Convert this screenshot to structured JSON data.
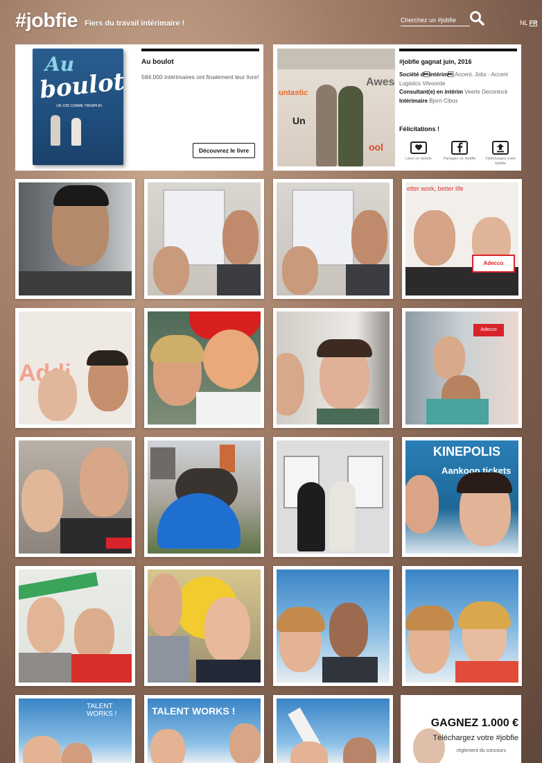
{
  "header": {
    "logo": "#jobfie",
    "tagline": "Fiers du travail intérimaire !",
    "search_placeholder": "Cherchez un #jobfie",
    "lang_nl": "NL",
    "lang_fr": "FR"
  },
  "book": {
    "cover_title_1": "Au",
    "cover_title_2": "boulot",
    "cover_subtitle": "UN JOB COMME TREMPLIN",
    "title": "Au boulot",
    "description": "584.000 intérimaires ont finalement leur livre!",
    "button": "Découvrez le livre"
  },
  "winner": {
    "title": "#jobfie gagnat juin, 2016",
    "company_label": "Société d\u0007intérim\u0007",
    "company_value": "Accent. Jobs - Accent Logistics Vilvoorde",
    "consultant_label": "Consultant(e) en intérim",
    "consultant_value": "Veerle Deconinck",
    "temp_label": "Intérimaire",
    "temp_value": "Bjorn Cibos",
    "congrats": "Félicitations !",
    "wall_text_1": "untastic",
    "wall_text_2": "Aweso",
    "wall_text_3": "Un",
    "wall_text_4": "ool",
    "actions": [
      {
        "icon": "heart-icon",
        "label": "Likez ce #jobfie"
      },
      {
        "icon": "facebook-icon",
        "label": "Partagez ce #jobfie"
      },
      {
        "icon": "upload-icon",
        "label": "Téléchargez votre #jobfie"
      }
    ]
  },
  "photo_texts": {
    "addi": "Addi",
    "adecco": "Adecco",
    "better_life": "etter work, better life",
    "kinepolis": "KINEPOLIS",
    "aankoop": "Aankoop tickets",
    "talent": "TALENT WORKS !"
  },
  "contest": {
    "headline": "GAGNEZ 1.000 €",
    "subline": "Téléchargez votre #jobfie",
    "rules": "règlement du concours"
  }
}
